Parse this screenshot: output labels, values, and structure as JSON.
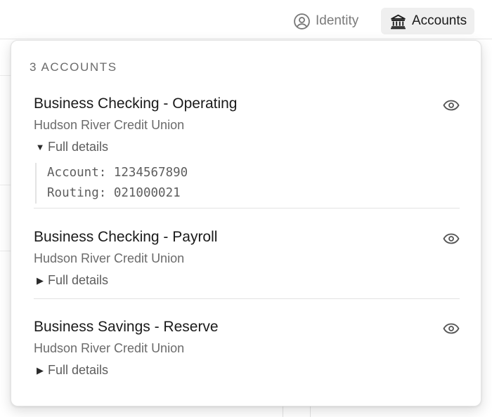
{
  "header": {
    "identity_label": "Identity",
    "accounts_label": "Accounts",
    "identity_icon": "user-circle-icon",
    "accounts_icon": "bank-icon"
  },
  "popover": {
    "count_label": "3 ACCOUNTS",
    "accounts": [
      {
        "name": "Business Checking - Operating",
        "institution": "Hudson River Credit Union",
        "details_label": "Full details",
        "expanded": true,
        "account_line": "Account: 1234567890",
        "routing_line": "Routing: 021000021"
      },
      {
        "name": "Business Checking - Payroll",
        "institution": "Hudson River Credit Union",
        "details_label": "Full details",
        "expanded": false
      },
      {
        "name": "Business Savings - Reserve",
        "institution": "Hudson River Credit Union",
        "details_label": "Full details",
        "expanded": false
      }
    ]
  },
  "colors": {
    "accent_bg": "#efefef",
    "text_primary": "#1a1a1a",
    "text_secondary": "#6b6b6b"
  }
}
